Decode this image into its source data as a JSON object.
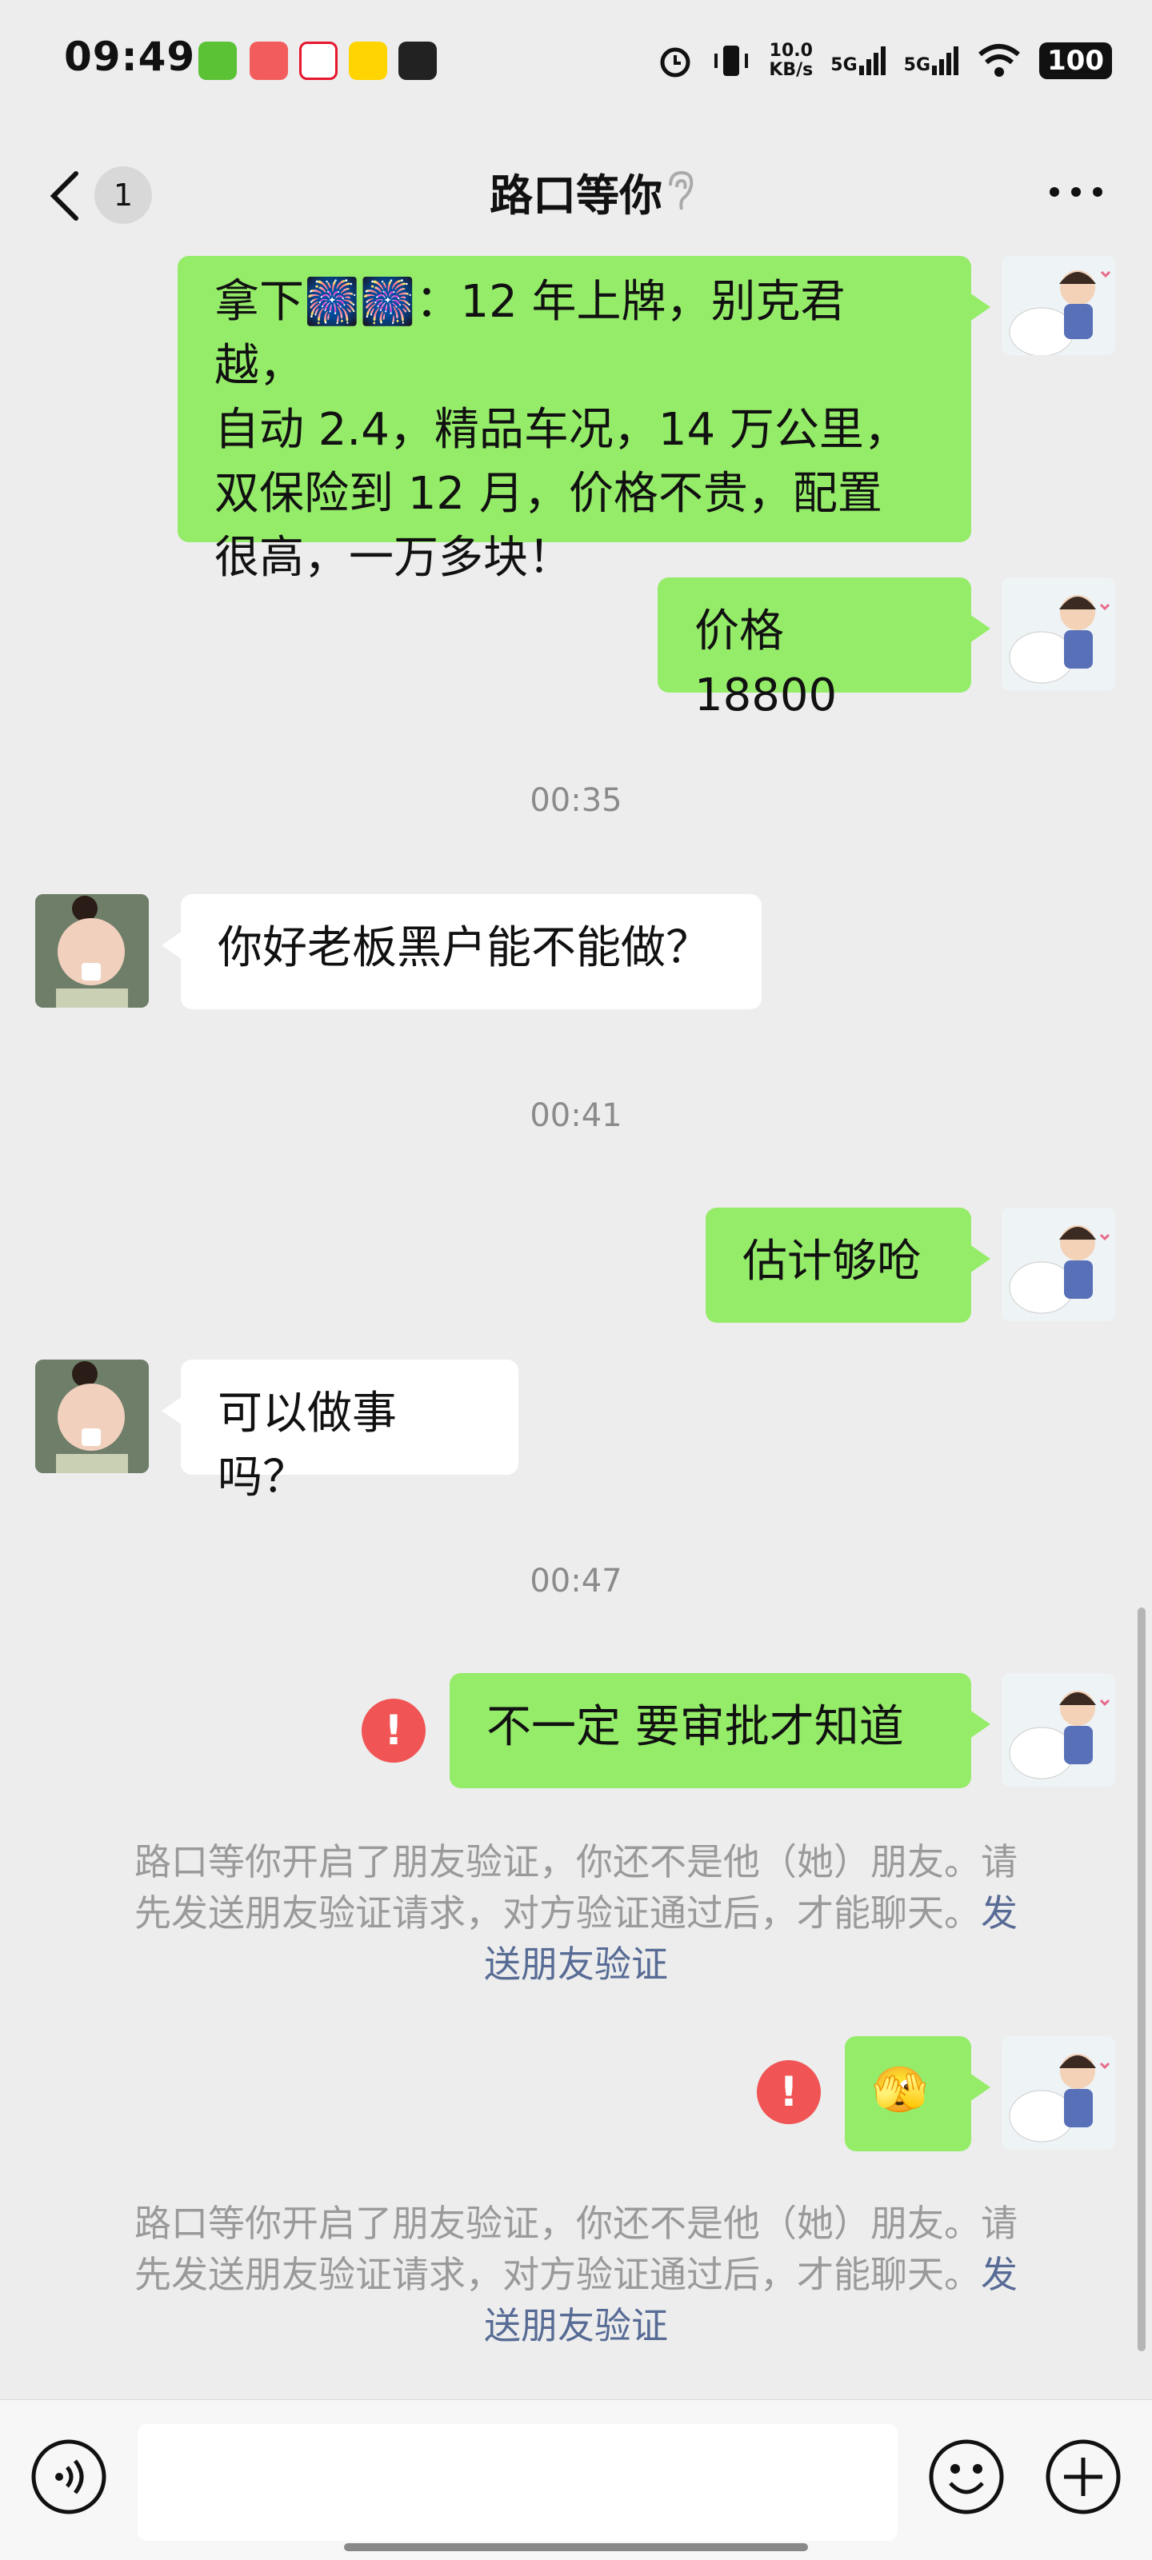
{
  "status_bar": {
    "time": "09:49",
    "net_speed_value": "10.0",
    "net_speed_unit": "KB/s",
    "signal1": "5G",
    "signal2": "5G",
    "battery": "100"
  },
  "header": {
    "unread_count": "1",
    "title": "路口等你"
  },
  "messages": {
    "m1_line1": "拿下🎆🎆：12 年上牌，别克君越，",
    "m1_line2": "自动 2.4，精品车况，14 万公里，",
    "m1_line3": "双保险到 12 月，价格不贵，配置",
    "m1_line4": "很高，一万多块！",
    "m2": "价格 18800",
    "ts1": "00:35",
    "m3": "你好老板黑户能不能做？",
    "ts2": "00:41",
    "m4": "估计够呛",
    "m5": "可以做事吗？",
    "ts3": "00:47",
    "m6": "不一定 要审批才知道",
    "m7_emoji": "🫣",
    "failed_mark": "!"
  },
  "system_notice": {
    "line1": "路口等你开启了朋友验证，你还不是他（她）朋友。请",
    "line2": "先发送朋友验证请求，对方验证通过后，才能聊天。",
    "link_part1": "发",
    "link_part2": "送朋友验证"
  },
  "colors": {
    "my_bubble": "#95ec69",
    "other_bubble": "#ffffff",
    "chat_bg": "#ededed",
    "error_red": "#f05454",
    "link_blue": "#576b95"
  },
  "icons": {
    "back": "chevron-left-icon",
    "ear": "ear-icon",
    "more": "more-icon",
    "voice": "voice-icon",
    "emoji": "emoji-icon",
    "add": "plus-icon"
  }
}
